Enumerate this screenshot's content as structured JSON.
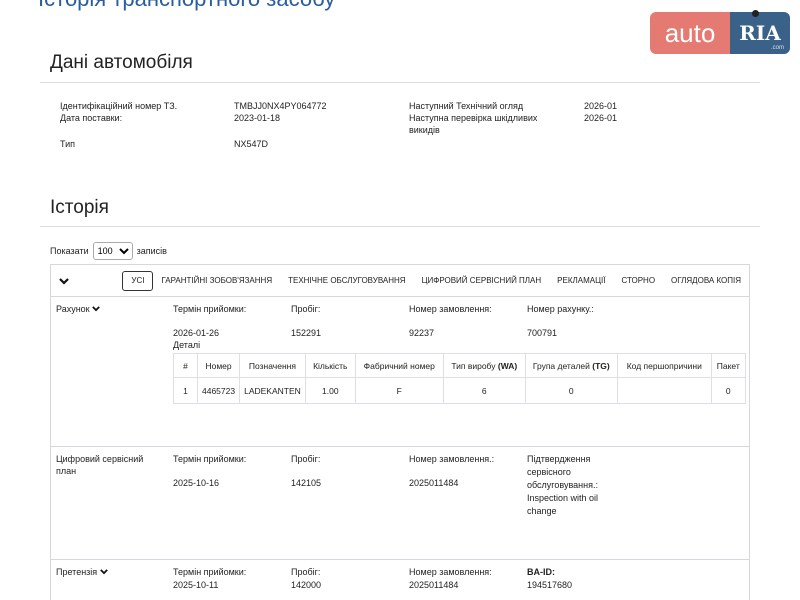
{
  "header": {
    "top_title": "Історія транспортного засобу",
    "logo_left": "auto",
    "logo_right": "RIA",
    "logo_suffix": ".com"
  },
  "vehicle": {
    "title": "Дані автомобіля",
    "vin_label": "Ідентифікаційний номер ТЗ.",
    "vin_value": "TMBJJ0NX4PY064772",
    "delivery_label": "Дата поставки:",
    "delivery_value": "2023-01-18",
    "type_label": "Тип",
    "type_value": "NX547D",
    "next_inspection_label": "Наступний Технічний огляд",
    "next_inspection_value": "2026-01",
    "next_emission_label_1": "Наступна перевірка шкідливих",
    "next_emission_label_2": "викидів",
    "next_emission_value": "2026-01"
  },
  "history": {
    "title": "Історія",
    "show_label": "Показати",
    "records_label": "записів",
    "page_size": "100",
    "filters": [
      "УСІ",
      "ГАРАНТІЙНІ ЗОБОВ'ЯЗАННЯ",
      "ТЕХНІЧНЕ ОБСЛУГОВУВАННЯ",
      "ЦИФРОВИЙ СЕРВІСНИЙ ПЛАН",
      "РЕКЛАМАЦІЇ",
      "СТОРНО",
      "ОГЛЯДОВА КОПІЯ"
    ],
    "records": [
      {
        "type": "Рахунок",
        "date_label": "Термін прийомки:",
        "date_value": "2026-01-26",
        "details_link": "Деталі",
        "mileage_label": "Пробіг:",
        "mileage_value": "152291",
        "order_label": "Номер замовлення:",
        "order_value": "92237",
        "extra_label": "Номер рахунку.:",
        "extra_value": "700791"
      },
      {
        "type_line1": "Цифровий сервісний",
        "type_line2": "план",
        "date_label": "Термін прийомки:",
        "date_value": "2025-10-16",
        "mileage_label": "Пробіг:",
        "mileage_value": "142105",
        "order_label": "Номер замовлення.:",
        "order_value": "2025011484",
        "extra_lines": [
          "Підтвердження",
          "сервісного",
          "обслуговування.:",
          "Inspection with oil",
          "change"
        ]
      },
      {
        "type": "Претензія",
        "date_label": "Термін прийомки:",
        "date_value": "2025-10-11",
        "mileage_label": "Пробіг:",
        "mileage_value": "142000",
        "order_label": "Номер замовлення:",
        "order_value": "2025011484",
        "extra_label": "BA-ID:",
        "extra_value": "194517680"
      }
    ],
    "parts_table": {
      "headers": [
        "#",
        "Номер",
        "Позначення",
        "Кількість",
        "Фабричний номер",
        "Тип виробу",
        "(WA)",
        "Група деталей",
        "(TG)",
        "Код першопричини",
        "Пакет"
      ],
      "row": [
        "1",
        "4465723",
        "LADEKANTEN",
        "1.00",
        "F",
        "6",
        "0",
        "",
        "0"
      ]
    }
  }
}
